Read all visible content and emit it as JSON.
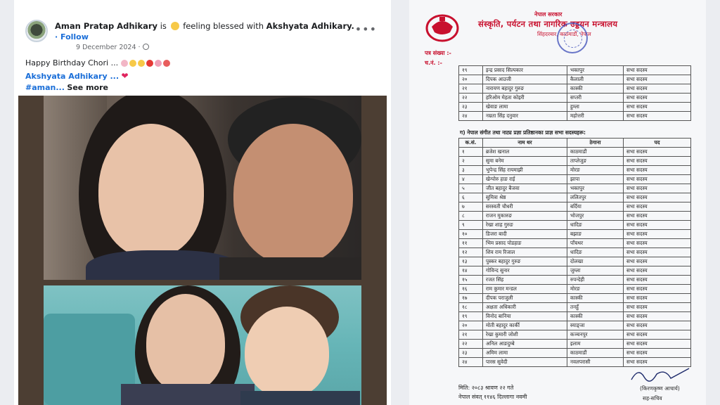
{
  "post": {
    "author": "Aman Pratap Adhikary",
    "activity_prefix": "is",
    "activity_text": "feeling blessed with",
    "tagged_person": "Akshyata Adhikary.",
    "follow_label": "· Follow",
    "date": "9 December 2024 ·",
    "more_label": "•••",
    "caption_line1": "Happy Birthday Chori ...",
    "caption_mention": "Akshyata Adhikary ...",
    "caption_hashtag": "#aman...",
    "see_more_label": "See more",
    "heart": "❤"
  },
  "document": {
    "government": "नेपाल सरकार",
    "ministry": "संस्कृति, पर्यटन तथा नागरिक उड्डयन मन्त्रालय",
    "address": "सिंहदरबार, काठमाडौं, नेपाल",
    "ref_label": "पत्र संख्या :-",
    "ref_label2": "च.नं. :-",
    "table1": [
      {
        "num": "१९",
        "name": "इन्द्र प्रसाद सिल्पकार",
        "place": "भक्तपुर",
        "post": "सभा सदस्य"
      },
      {
        "num": "२०",
        "name": "दिपक आउजी",
        "place": "कैलाली",
        "post": "सभा सदस्य"
      },
      {
        "num": "२१",
        "name": "नारायण बहादुर गुरुङ",
        "place": "कास्की",
        "post": "सभा सदस्य"
      },
      {
        "num": "२२",
        "name": "हरिओम मेहता कोइरी",
        "place": "सप्तरी",
        "post": "सभा सदस्य"
      },
      {
        "num": "२३",
        "name": "खेवाङ लामा",
        "place": "हुम्ला",
        "post": "सभा सदस्य"
      },
      {
        "num": "२४",
        "name": "नम्रता सिंह दनुवार",
        "place": "महोत्तरी",
        "post": "सभा सदस्य"
      }
    ],
    "section_heading": "ग) नेपाल संगीत तथा नाट्य प्रज्ञा प्रतिष्ठानका प्राज्ञ सभा सदस्यहरू:",
    "table2_headers": [
      "क.सं.",
      "नाम थर",
      "ठेगाना",
      "पद"
    ],
    "table2": [
      {
        "num": "१",
        "name": "ब्रजेश खनाल",
        "place": "काठमाडौं",
        "post": "सभा सदस्य"
      },
      {
        "num": "२",
        "name": "सुमा बनेम",
        "place": "ताप्लेजुङ",
        "post": "सभा सदस्य"
      },
      {
        "num": "३",
        "name": "भुपेन्द्र सिंह रायमाझी",
        "place": "मोरङ",
        "post": "सभा सदस्य"
      },
      {
        "num": "४",
        "name": "खेन्पोरु हाङ राई",
        "place": "झापा",
        "post": "सभा सदस्य"
      },
      {
        "num": "५",
        "name": "जीत बहादुर बैजवा",
        "place": "भक्तपुर",
        "post": "सभा सदस्य"
      },
      {
        "num": "६",
        "name": "सुमित्रा श्रेष्ठ",
        "place": "ललितपुर",
        "post": "सभा सदस्य"
      },
      {
        "num": "७",
        "name": "सरस्वती चौधरी",
        "place": "बर्दिया",
        "post": "सभा सदस्य"
      },
      {
        "num": "८",
        "name": "राजन मुकारुङ",
        "place": "भोजपुर",
        "post": "सभा सदस्य"
      },
      {
        "num": "९",
        "name": "रेखा शाह गुरुङ",
        "place": "धादिङ",
        "post": "सभा सदस्य"
      },
      {
        "num": "१०",
        "name": "डिजरा बादी",
        "place": "बझाङ",
        "post": "सभा सदस्य"
      },
      {
        "num": "११",
        "name": "भिम प्रसाद पोडहाङ",
        "place": "पाँचथर",
        "post": "सभा सदस्य"
      },
      {
        "num": "१२",
        "name": "शिव राम रिजाल",
        "place": "धादिङ",
        "post": "सभा सदस्य"
      },
      {
        "num": "१३",
        "name": "पुस्कर बहादुर गुरुङ",
        "place": "दोलखा",
        "post": "सभा सदस्य"
      },
      {
        "num": "१४",
        "name": "गोविन्द सुनार",
        "place": "जुम्ला",
        "post": "सभा सदस्य"
      },
      {
        "num": "१५",
        "name": "रजत सिंह",
        "place": "रुपन्देही",
        "post": "सभा सदस्य"
      },
      {
        "num": "१६",
        "name": "राम कुमार मन्डल",
        "place": "मोरङ",
        "post": "सभा सदस्य"
      },
      {
        "num": "१७",
        "name": "दीपक पराजुली",
        "place": "कास्की",
        "post": "सभा सदस्य"
      },
      {
        "num": "१८",
        "name": "अक्षता अधिकारी",
        "place": "तनहुँ",
        "post": "सभा सदस्य"
      },
      {
        "num": "१९",
        "name": "विनोद बानिया",
        "place": "कास्की",
        "post": "सभा सदस्य"
      },
      {
        "num": "२०",
        "name": "मोती बहादुर कार्की",
        "place": "स्याङ्जा",
        "post": "सभा सदस्य"
      },
      {
        "num": "२१",
        "name": "रेखा कुमारी जोशी",
        "place": "कञ्चनपुर",
        "post": "सभा सदस्य"
      },
      {
        "num": "२२",
        "name": "अनिल आङदुम्बे",
        "place": "इलाम",
        "post": "सभा सदस्य"
      },
      {
        "num": "२३",
        "name": "अमिम लामा",
        "place": "काठमाडौं",
        "post": "सभा सदस्य"
      },
      {
        "num": "२४",
        "name": "पारस सुवेदी",
        "place": "नवलपरासी",
        "post": "सभा सदस्य"
      }
    ],
    "footer_date": "मिति: २०८३ श्रावण २२ गते",
    "footer_era": "नेपाल संवत् ११४६ दिल्लागा नवमी",
    "signer_name": "(किरणकृष्ण आचार्य)",
    "signer_role": "सह-सचिव"
  },
  "colors": {
    "fb_link": "#1a6ed8",
    "doc_red": "#c8102e"
  }
}
